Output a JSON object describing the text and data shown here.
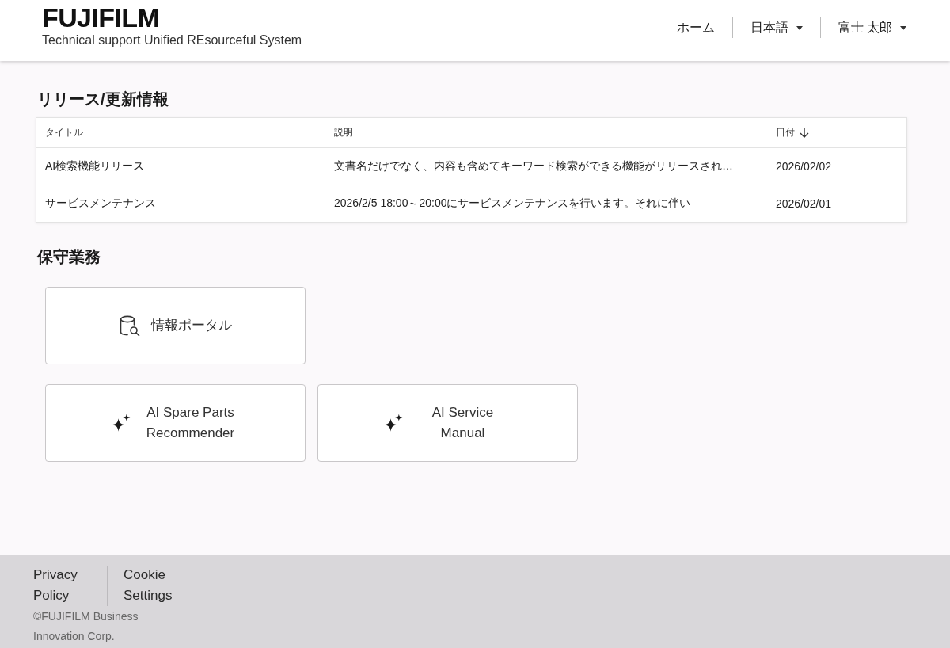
{
  "header": {
    "logo": "FUJIFILM",
    "subtitle": "Technical support Unified REsourceful System",
    "nav": [
      {
        "label": "ホーム",
        "kind": "link"
      },
      {
        "label": "日本語",
        "kind": "dropdown"
      },
      {
        "label": "富士 太郎",
        "kind": "dropdown"
      }
    ]
  },
  "releases": {
    "title": "リリース/更新情報",
    "columns": [
      {
        "label": "タイトル",
        "sorted": false
      },
      {
        "label": "説明",
        "sorted": false
      },
      {
        "label": "日付",
        "sorted": true,
        "descending": true
      }
    ],
    "rows": [
      [
        "AI検索機能リリース",
        "文書名だけでなく、内容も含めてキーワード検索ができる機能がリリースされ…",
        "2026/02/02"
      ],
      [
        "サービスメンテナンス",
        "2026/2/5 18:00～20:00にサービスメンテナンスを行います。それに伴い",
        "2026/02/01"
      ]
    ]
  },
  "maintenance": {
    "title": "保守業務",
    "card_rows": [
      [
        {
          "label": "情報ポータル",
          "kind": "portal"
        }
      ],
      [
        {
          "label": "AI Spare Parts Recommender",
          "kind": "ai"
        },
        {
          "label": "AI Service Manual",
          "kind": "ai"
        }
      ]
    ]
  },
  "footer": {
    "links": [
      "Privacy Policy",
      "Cookie Settings"
    ],
    "copyright": "©FUJIFILM Business Innovation Corp."
  }
}
